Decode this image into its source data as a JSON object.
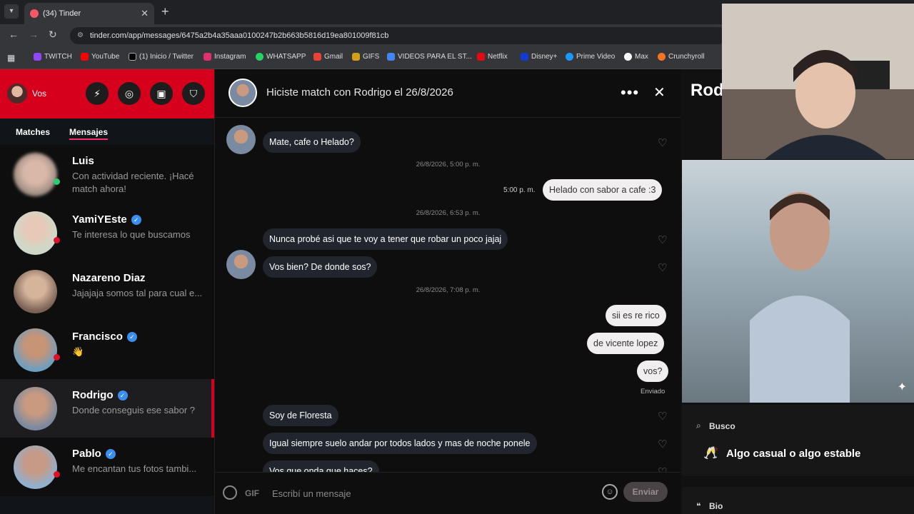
{
  "browser": {
    "tab_title": "(34) Tinder",
    "url": "tinder.com/app/messages/6475a2b4a35aaa0100247b2b663b5816d19ea801009f81cb",
    "bookmarks": [
      "TWITCH",
      "YouTube",
      "(1) Inicio / Twitter",
      "Instagram",
      "WHATSAPP",
      "Gmail",
      "GIFS",
      "VIDEOS PARA EL ST...",
      "Netflix",
      "Disney+",
      "Prime Video",
      "Max",
      "Crunchyroll"
    ]
  },
  "sidebar": {
    "user_label": "Vos",
    "tabs": [
      "Matches",
      "Mensajes"
    ],
    "conversations": [
      {
        "name": "Luis",
        "last": "Con actividad reciente. ¡Hacé match ahora!",
        "verified": false,
        "dot": "#2ecc71"
      },
      {
        "name": "YamiYEste",
        "last": "Te interesa lo que buscamos",
        "verified": true,
        "dot": "#e0102a"
      },
      {
        "name": "Nazareno Diaz",
        "last": "Jajajaja somos tal para cual e...",
        "verified": false,
        "dot": ""
      },
      {
        "name": "Francisco",
        "last": "👋",
        "verified": true,
        "dot": "#e0102a"
      },
      {
        "name": "Rodrigo",
        "last": "Donde conseguis ese sabor ?",
        "verified": true,
        "dot": ""
      },
      {
        "name": "Pablo",
        "last": "Me encantan tus fotos tambi...",
        "verified": true,
        "dot": "#e0102a"
      }
    ]
  },
  "chat": {
    "title": "Hiciste match con Rodrigo el 26/8/2026",
    "messages": [
      {
        "text": "Mate, cafe o Helado?"
      },
      {
        "text": "26/8/2026, 5:00 p. m."
      },
      {
        "text": "5:00 p. m."
      },
      {
        "text": "Helado con sabor a cafe :3"
      },
      {
        "text": "26/8/2026, 6:53 p. m."
      },
      {
        "text": "Nunca probé asi que te voy a tener que robar un poco jajaj"
      },
      {
        "text": "Vos bien? De donde sos?"
      },
      {
        "text": "26/8/2026, 7:08 p. m."
      },
      {
        "text": "sii es re rico"
      },
      {
        "text": "de vicente lopez"
      },
      {
        "text": "vos?"
      },
      {
        "text": "Enviado"
      },
      {
        "text": "Soy de Floresta"
      },
      {
        "text": "Igual siempre suelo andar por todos lados y mas de noche ponele"
      },
      {
        "text": "Vos que onda que haces?"
      }
    ],
    "composer": {
      "gif": "GIF",
      "placeholder": "Escribí un mensaje",
      "send": "Enviar"
    }
  },
  "profile": {
    "name": "Rod",
    "looking_title": "Busco",
    "looking_value": "Algo casual o algo estable",
    "bio_title": "Bio"
  }
}
